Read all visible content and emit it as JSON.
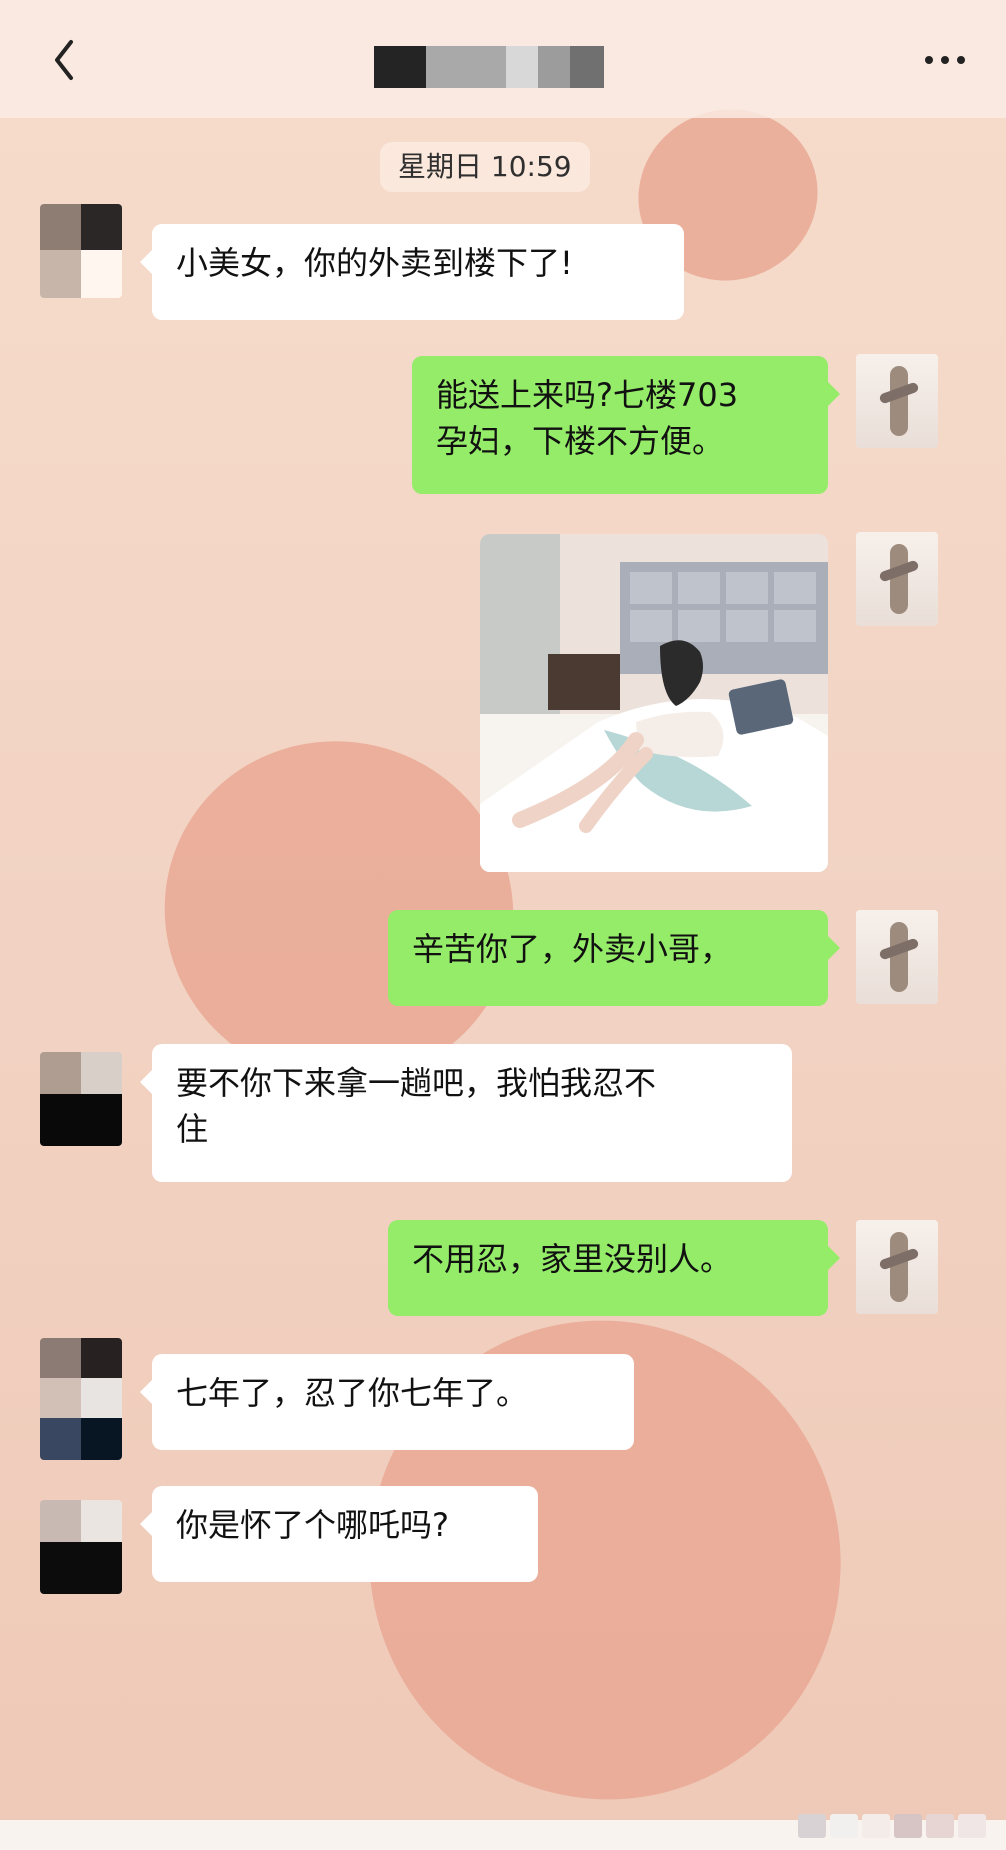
{
  "header": {
    "time_chip": "星期日 10:59"
  },
  "messages": [
    {
      "text": "小美女，你的外卖到楼下了!"
    },
    {
      "text": "能送上来吗?七楼703\n孕妇，下楼不方便。"
    },
    {
      "text": ""
    },
    {
      "text": "辛苦你了，外卖小哥，"
    },
    {
      "text": "要不你下来拿一趟吧，我怕我忍不\n住"
    },
    {
      "text": "不用忍，家里没别人。"
    },
    {
      "text": "七年了，忍了你七年了。"
    },
    {
      "text": "你是怀了个哪吒吗?"
    }
  ],
  "icons": {
    "back": "chevron-left-icon",
    "more": "more-horizontal-icon"
  },
  "colors": {
    "background": "#f3d5c6",
    "heart": "#e9a894",
    "sent_bubble": "#95ec69",
    "received_bubble": "#ffffff"
  }
}
